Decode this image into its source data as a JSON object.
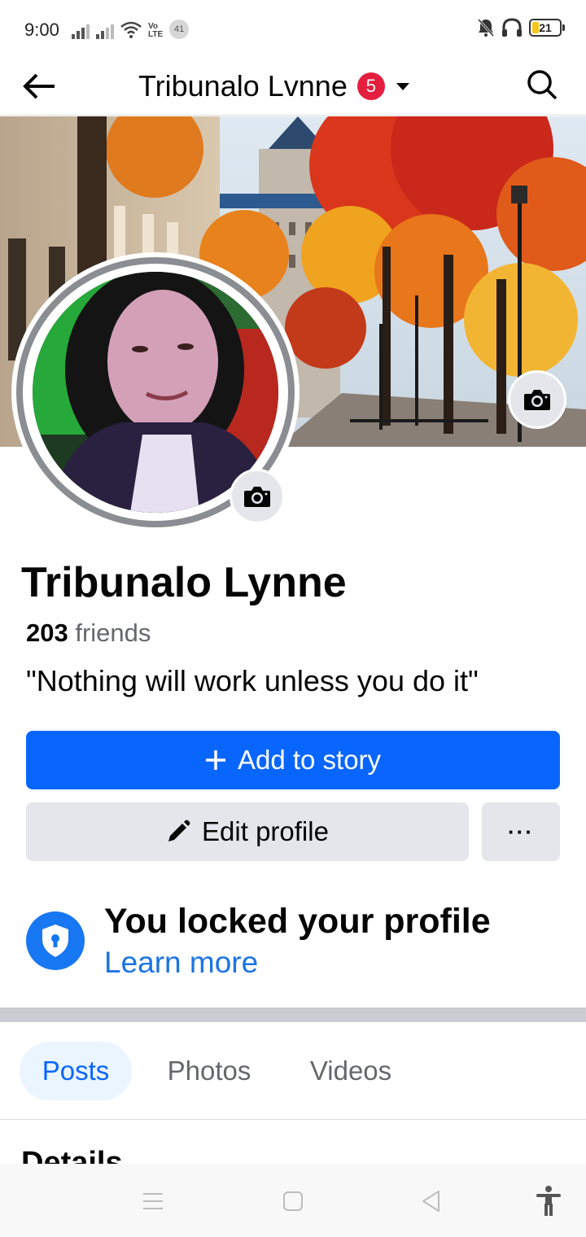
{
  "status_bar": {
    "time": "9:00",
    "volte_line1": "Vo",
    "volte_line2": "LTE",
    "notification_count": "41",
    "battery_level": "21"
  },
  "header": {
    "title": "Tribunalo Lvnne",
    "badge_count": "5"
  },
  "profile": {
    "name": "Tribunalo Lynne",
    "friends_count": "203",
    "friends_label": "friends",
    "bio": "\"Nothing will work unless you do it\""
  },
  "actions": {
    "add_story_label": "Add to story",
    "edit_profile_label": "Edit profile",
    "more_label": "···"
  },
  "lock_notice": {
    "title": "You locked your profile",
    "link": "Learn more"
  },
  "tabs": [
    {
      "label": "Posts",
      "active": true
    },
    {
      "label": "Photos",
      "active": false
    },
    {
      "label": "Videos",
      "active": false
    }
  ],
  "details_heading": "Details",
  "colors": {
    "primary": "#0866ff",
    "link": "#1b74e4",
    "badge": "#e41e3f",
    "button_gray": "#e4e6eb"
  }
}
